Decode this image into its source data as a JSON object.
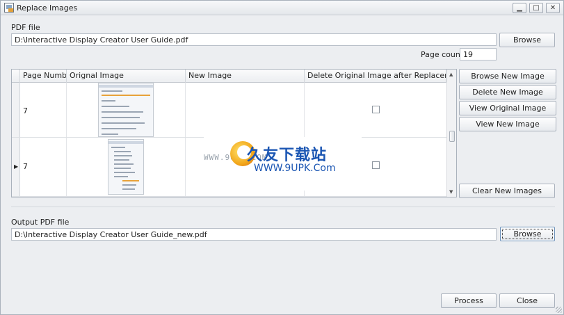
{
  "window": {
    "title": "Replace Images",
    "minimize": "▁",
    "maximize": "□",
    "close": "✕"
  },
  "pdf_file": {
    "label": "PDF file",
    "value": "D:\\Interactive Display Creator User Guide.pdf",
    "browse_label": "Browse"
  },
  "page_count": {
    "label": "Page count",
    "value": "19"
  },
  "table": {
    "columns": [
      "Page Number",
      "Orignal Image",
      "New Image",
      "Delete Original Image after Replacement"
    ],
    "rows": [
      {
        "page_number": "7",
        "delete_checked": false,
        "current": false
      },
      {
        "page_number": "7",
        "delete_checked": false,
        "current": true
      }
    ]
  },
  "side_buttons": {
    "browse_new": "Browse New Image",
    "delete_new": "Delete New Image",
    "view_original": "View Original Image",
    "view_new": "View New Image",
    "clear_new": "Clear New Images"
  },
  "output_pdf": {
    "label": "Output PDF file",
    "value": "D:\\Interactive Display Creator User Guide_new.pdf",
    "browse_label": "Browse"
  },
  "footer": {
    "process": "Process",
    "close": "Close"
  },
  "watermark": {
    "cn": "久友下载站",
    "url": "WWW.9UPK.Com",
    "faint": "WWW.9UPK.COM"
  },
  "colors": {
    "window_bg": "#eceef1",
    "accent": "#1b56b3"
  }
}
